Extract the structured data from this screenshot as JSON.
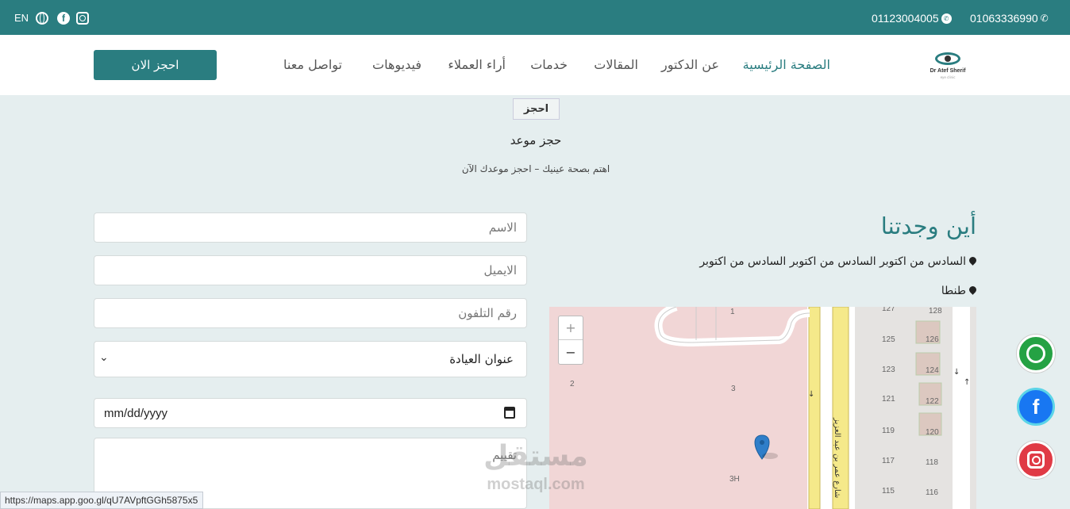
{
  "topbar": {
    "lang": "EN",
    "phone1": "01123004005",
    "phone2": "01063336990",
    "icons": [
      "globe-icon",
      "facebook-icon",
      "instagram-icon",
      "whatsapp-icon",
      "phone-icon"
    ]
  },
  "nav": {
    "cta": "احجز الان",
    "items": [
      "الصفحة الرئيسية",
      "عن الدكتور",
      "المقالات",
      "خدمات",
      "أراء العملاء",
      "فيديوهات",
      "تواصل معنا"
    ],
    "logo_name": "Dr Atef Sherif",
    "logo_sub": "eye clinic"
  },
  "section": {
    "badge": "احجز",
    "title": "حجز موعد",
    "subtitle": "اهتم بصحة عينيك – احجز موعدك الآن"
  },
  "form": {
    "name_placeholder": "الاسم",
    "email_placeholder": "الايميل",
    "phone_placeholder": "رقم التلفون",
    "clinic_select": "عنوان العيادة",
    "date_value": "mm/dd/yyyy",
    "notes_placeholder": "تقييم"
  },
  "location": {
    "title": "أين وجدتنا",
    "address": "السادس من اكتوبر السادس من اكتوبر السادس من اكتوبر",
    "city": "طنطا",
    "map": {
      "zoom_in": "+",
      "zoom_out": "−",
      "labels": [
        "1",
        "2",
        "3",
        "3H",
        "127",
        "128",
        "125",
        "126",
        "123",
        "124",
        "121",
        "122",
        "119",
        "120",
        "117",
        "118",
        "115",
        "116"
      ],
      "street": "شارع عمر بن عبد العزيز"
    }
  },
  "colors": {
    "primary": "#2a7d80",
    "whatsapp": "#25a244",
    "facebook": "#1877f2",
    "instagram": "#e03a45"
  },
  "status_url": "https://maps.app.goo.gl/qU7AVpftGGh5875x5",
  "watermark": {
    "main": "مستقل",
    "sub": "mostaql.com"
  }
}
